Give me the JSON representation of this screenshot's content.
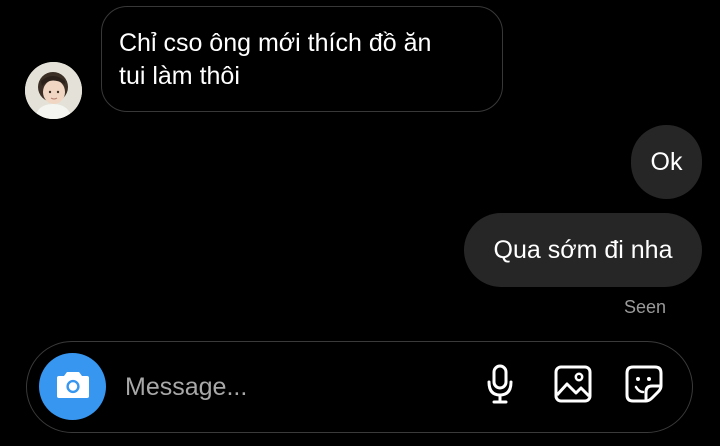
{
  "conversation": {
    "messages": [
      {
        "direction": "incoming",
        "text": "Chỉ cso ông mới thích đồ ăn\ntui làm thôi"
      },
      {
        "direction": "outgoing",
        "text": "Ok"
      },
      {
        "direction": "outgoing",
        "text": "Qua sớm đi nha"
      }
    ],
    "status": "Seen"
  },
  "composer": {
    "placeholder": "Message...",
    "icons": [
      "camera-icon",
      "microphone-icon",
      "gallery-icon",
      "sticker-icon"
    ]
  },
  "colors": {
    "background": "#000000",
    "outgoing_bubble": "#262626",
    "incoming_border": "#383838",
    "camera_button": "#3797f0",
    "seen_text": "#9b9b9b",
    "placeholder_text": "#a8a8a8"
  }
}
